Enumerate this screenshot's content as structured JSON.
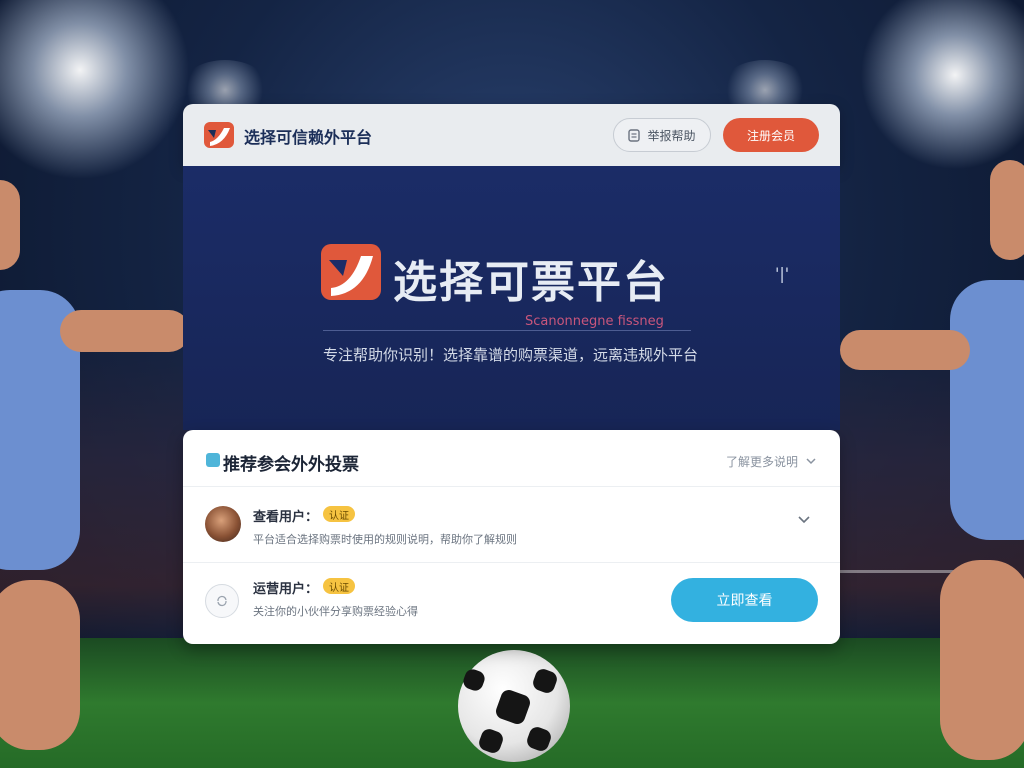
{
  "header": {
    "brand_title": "选择可信赖外平台",
    "login_label": "举报帮助",
    "register_label": "注册会员"
  },
  "hero": {
    "title": "选择可票平台",
    "corner_mark": "'|'",
    "subtitle_en": "Scanonnegne fissneg",
    "description": "专注帮助你识别！选择靠谱的购票渠道，远离违规外平台"
  },
  "card": {
    "title": "推荐参会外外投票",
    "more_label": "了解更多说明",
    "rows": [
      {
        "name": "查看用户：",
        "badge": "认证",
        "text": "平台适合选择购票时使用的规则说明，帮助你了解规则",
        "has_chevron": true
      },
      {
        "name": "运营用户：",
        "badge": "认证",
        "text": "关注你的小伙伴分享购票经验心得",
        "action_label": "立即查看"
      }
    ]
  },
  "colors": {
    "accent_orange": "#e0583b",
    "accent_cyan": "#33b1e0",
    "hero_navy": "#1b2c67",
    "badge_yellow": "#f6c341"
  },
  "icons": {
    "logo": "brand-logo-icon",
    "login": "document-icon",
    "more": "chevron-down-icon",
    "row_chevron": "chevron-down-icon",
    "row2_avatar": "refresh-icon"
  }
}
